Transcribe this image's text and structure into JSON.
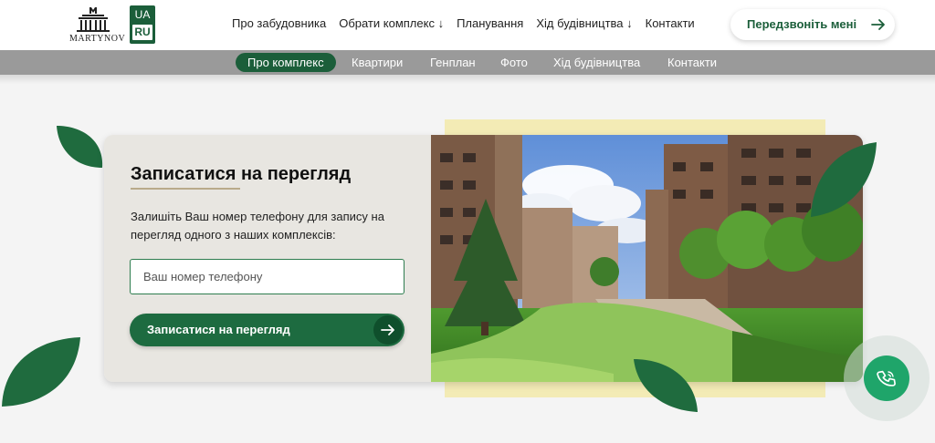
{
  "header": {
    "logo_text": "MARTYNOV",
    "lang": {
      "current": "UA",
      "other": "RU"
    },
    "nav": [
      {
        "label": "Про забудовника"
      },
      {
        "label": "Обрати комплекс ↓"
      },
      {
        "label": "Планування"
      },
      {
        "label": "Хід будівництва ↓"
      },
      {
        "label": "Контакти"
      }
    ],
    "callback_label": "Передзвоніть мені"
  },
  "subnav": {
    "items": [
      {
        "label": "Про комплекс",
        "active": true
      },
      {
        "label": "Квартири"
      },
      {
        "label": "Генплан"
      },
      {
        "label": "Фото"
      },
      {
        "label": "Хід будівництва"
      },
      {
        "label": "Контакти"
      }
    ]
  },
  "form": {
    "title": "Записатися на перегляд",
    "description": "Залишіть Ваш номер телефону для запису на перегляд одного з наших комплексів:",
    "phone_placeholder": "Ваш номер телефону",
    "submit_label": "Записатися на перегляд"
  },
  "colors": {
    "brand_green": "#1b5e3a",
    "button_green": "#1d6b40",
    "fab_green": "#1fa56a",
    "accent_yellow": "#f3ebb5"
  },
  "icons": {
    "callback": "arrow-right-icon",
    "submit": "arrow-right-icon",
    "fab": "phone-icon"
  }
}
